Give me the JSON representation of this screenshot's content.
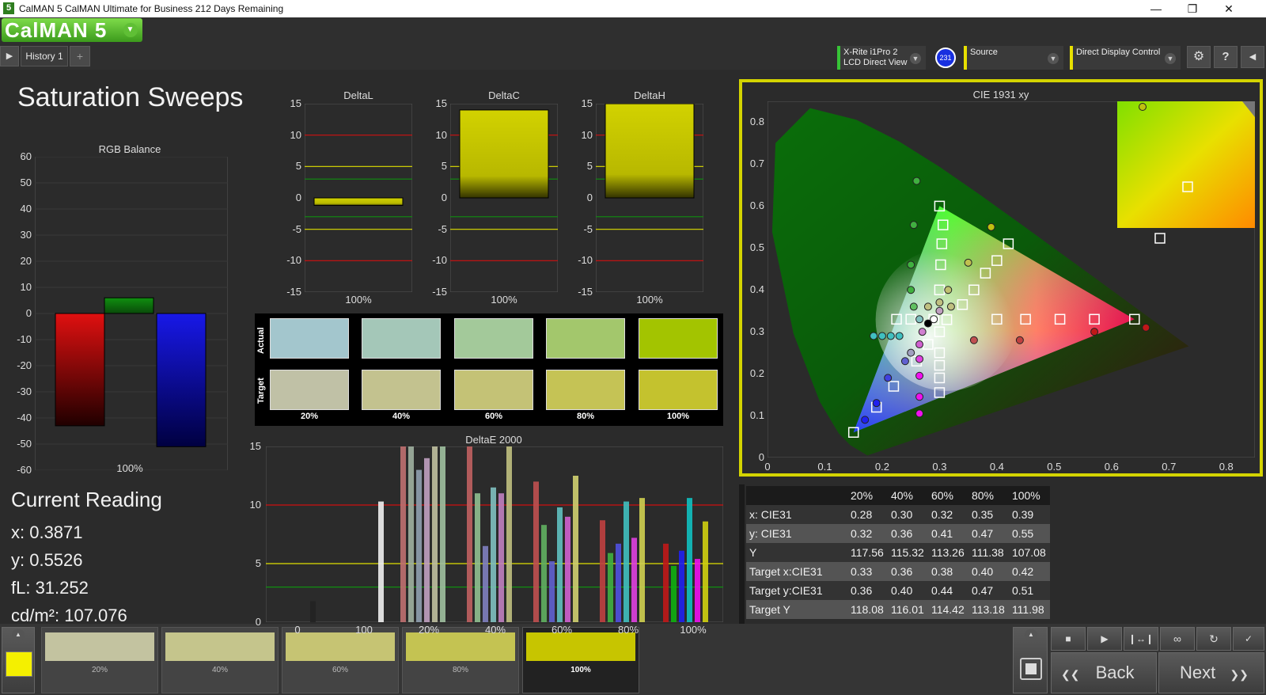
{
  "window": {
    "title": "CalMAN 5 CalMAN Ultimate for Business 212 Days Remaining",
    "app_badge": "5"
  },
  "toolbar": {
    "brand": "CalMAN 5",
    "tab": "History 1",
    "add_tab": "+",
    "meter": {
      "line1": "X-Rite i1Pro 2",
      "line2": "LCD Direct View",
      "badge": "231"
    },
    "source": "Source",
    "display": "Direct Display Control"
  },
  "page": {
    "title": "Saturation Sweeps"
  },
  "rgb_balance": {
    "title": "RGB Balance",
    "ticks": [
      "60",
      "50",
      "40",
      "30",
      "20",
      "10",
      "0",
      "-10",
      "-20",
      "-30",
      "-40",
      "-50",
      "-60"
    ],
    "category": "100%",
    "bars": [
      {
        "name": "red",
        "value": -43,
        "color": "#e01010"
      },
      {
        "name": "green",
        "value": 6,
        "color": "#109010"
      },
      {
        "name": "blue",
        "value": -51,
        "color": "#1818e8"
      }
    ]
  },
  "delta_charts": {
    "ticks": [
      "15",
      "10",
      "5",
      "0",
      "-5",
      "-10",
      "-15"
    ],
    "charts": [
      {
        "title": "DeltaL",
        "value": -1.2,
        "category": "100%"
      },
      {
        "title": "DeltaC",
        "value": 14,
        "category": "100%"
      },
      {
        "title": "DeltaH",
        "value": 15,
        "category": "100%"
      }
    ]
  },
  "swatches": {
    "actual_label": "Actual",
    "target_label": "Target",
    "labels": [
      "20%",
      "40%",
      "60%",
      "80%",
      "100%"
    ],
    "actual": [
      "#a3c6cd",
      "#a4c7b8",
      "#a3c99a",
      "#a3c76c",
      "#a3c400"
    ],
    "target": [
      "#c0c1a6",
      "#c3c28f",
      "#c4c276",
      "#c5c355",
      "#c4c22e"
    ]
  },
  "deltae_chart": {
    "title": "DeltaE 2000",
    "ticks": [
      "15",
      "10",
      "5",
      "0"
    ],
    "categories": [
      "0",
      "100",
      "20%",
      "40%",
      "60%",
      "80%",
      "100%"
    ],
    "ylim": [
      0,
      15
    ]
  },
  "current_reading": {
    "title": "Current Reading",
    "x": "x: 0.3871",
    "y": "y: 0.5526",
    "fl": "fL: 31.252",
    "cd": "cd/m²: 107.076"
  },
  "cie": {
    "title": "CIE 1931 xy",
    "xticks": [
      "0",
      "0.1",
      "0.2",
      "0.3",
      "0.4",
      "0.5",
      "0.6",
      "0.7",
      "0.8"
    ],
    "yticks": [
      "0.8",
      "0.7",
      "0.6",
      "0.5",
      "0.4",
      "0.3",
      "0.2",
      "0.1",
      "0"
    ]
  },
  "data_table": {
    "columns": [
      "20%",
      "40%",
      "60%",
      "80%",
      "100%"
    ],
    "rows": [
      {
        "label": "x: CIE31",
        "values": [
          "0.28",
          "0.30",
          "0.32",
          "0.35",
          "0.39"
        ]
      },
      {
        "label": "y: CIE31",
        "values": [
          "0.32",
          "0.36",
          "0.41",
          "0.47",
          "0.55"
        ]
      },
      {
        "label": "Y",
        "values": [
          "117.56",
          "115.32",
          "113.26",
          "111.38",
          "107.08"
        ]
      },
      {
        "label": "Target x:CIE31",
        "values": [
          "0.33",
          "0.36",
          "0.38",
          "0.40",
          "0.42"
        ]
      },
      {
        "label": "Target y:CIE31",
        "values": [
          "0.36",
          "0.40",
          "0.44",
          "0.47",
          "0.51"
        ]
      },
      {
        "label": "Target Y",
        "values": [
          "118.08",
          "116.01",
          "114.42",
          "113.18",
          "111.98"
        ]
      }
    ]
  },
  "bottom_bar": {
    "current_color": "#f4f000",
    "steps": [
      {
        "label": "20%",
        "color": "#c3c3a0"
      },
      {
        "label": "40%",
        "color": "#c5c58c"
      },
      {
        "label": "60%",
        "color": "#c6c473"
      },
      {
        "label": "80%",
        "color": "#c4c352"
      },
      {
        "label": "100%",
        "color": "#c7c500"
      }
    ],
    "back": "Back",
    "next": "Next"
  }
}
